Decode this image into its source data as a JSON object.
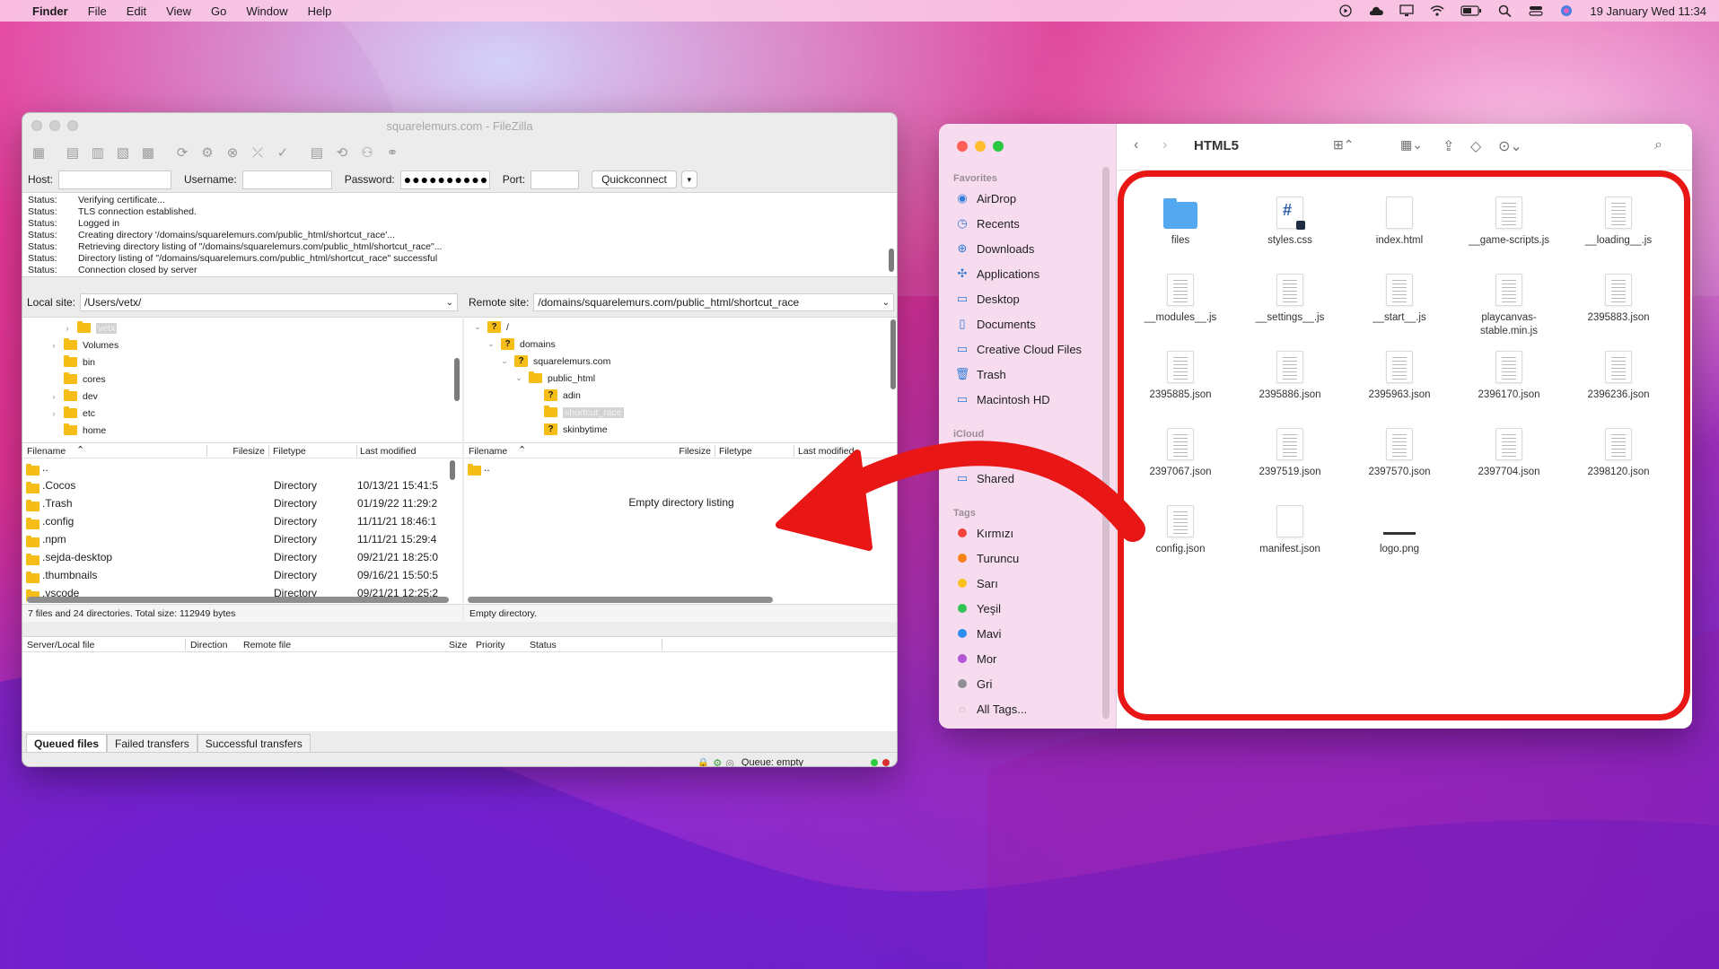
{
  "menubar": {
    "app": "Finder",
    "items": [
      "File",
      "Edit",
      "View",
      "Go",
      "Window",
      "Help"
    ],
    "clock": "19 January Wed  11:34"
  },
  "filezilla": {
    "title": "squarelemurs.com - FileZilla",
    "quickconnect": {
      "host_label": "Host:",
      "host_value": "",
      "username_label": "Username:",
      "username_value": "",
      "password_label": "Password:",
      "password_value": "●●●●●●●●●●●●",
      "port_label": "Port:",
      "port_value": "",
      "button": "Quickconnect"
    },
    "log": [
      {
        "k": "Status:",
        "v": "Verifying certificate..."
      },
      {
        "k": "Status:",
        "v": "TLS connection established."
      },
      {
        "k": "Status:",
        "v": "Logged in"
      },
      {
        "k": "Status:",
        "v": "Creating directory '/domains/squarelemurs.com/public_html/shortcut_race'..."
      },
      {
        "k": "Status:",
        "v": "Retrieving directory listing of \"/domains/squarelemurs.com/public_html/shortcut_race\"..."
      },
      {
        "k": "Status:",
        "v": "Directory listing of \"/domains/squarelemurs.com/public_html/shortcut_race\" successful"
      },
      {
        "k": "Status:",
        "v": "Connection closed by server"
      }
    ],
    "local": {
      "label": "Local site:",
      "path": "/Users/vetx/",
      "tree": [
        "vetx",
        "Volumes",
        "bin",
        "cores",
        "dev",
        "etc",
        "home"
      ],
      "headers": {
        "filename": "Filename",
        "filesize": "Filesize",
        "filetype": "Filetype",
        "modified": "Last modified"
      },
      "files": [
        {
          "name": "..",
          "type": "",
          "modified": ""
        },
        {
          "name": ".Cocos",
          "type": "Directory",
          "modified": "10/13/21 15:41:5"
        },
        {
          "name": ".Trash",
          "type": "Directory",
          "modified": "01/19/22 11:29:2"
        },
        {
          "name": ".config",
          "type": "Directory",
          "modified": "11/11/21 18:46:1"
        },
        {
          "name": ".npm",
          "type": "Directory",
          "modified": "11/11/21 15:29:4"
        },
        {
          "name": ".sejda-desktop",
          "type": "Directory",
          "modified": "09/21/21 18:25:0"
        },
        {
          "name": ".thumbnails",
          "type": "Directory",
          "modified": "09/16/21 15:50:5"
        },
        {
          "name": ".vscode",
          "type": "Directory",
          "modified": "09/21/21 12:25:2"
        }
      ],
      "status": "7 files and 24 directories. Total size: 112949 bytes"
    },
    "remote": {
      "label": "Remote site:",
      "path": "/domains/squarelemurs.com/public_html/shortcut_race",
      "tree": [
        "/",
        "domains",
        "squarelemurs.com",
        "public_html",
        "adin",
        "shortcut_race",
        "skinbytime"
      ],
      "headers": {
        "filename": "Filename",
        "filesize": "Filesize",
        "filetype": "Filetype",
        "modified": "Last modified"
      },
      "files": [
        {
          "name": ".."
        }
      ],
      "empty": "Empty directory listing",
      "status": "Empty directory."
    },
    "queue": {
      "headers": {
        "local": "Server/Local file",
        "direction": "Direction",
        "remote": "Remote file",
        "size": "Size",
        "priority": "Priority",
        "status": "Status"
      },
      "tabs": [
        "Queued files",
        "Failed transfers",
        "Successful transfers"
      ],
      "queue_status": "Queue: empty"
    }
  },
  "finder": {
    "folder_title": "HTML5",
    "sections": {
      "favorites": "Favorites",
      "icloud": "iCloud",
      "tags": "Tags"
    },
    "favorites": [
      "AirDrop",
      "Recents",
      "Downloads",
      "Applications",
      "Desktop",
      "Documents",
      "Creative Cloud Files",
      "Trash",
      "Macintosh HD"
    ],
    "icloud": [
      "Shared"
    ],
    "tags": [
      {
        "name": "Kırmızı",
        "color": "#f0433a"
      },
      {
        "name": "Turuncu",
        "color": "#f7821b"
      },
      {
        "name": "Sarı",
        "color": "#f9c11c"
      },
      {
        "name": "Yeşil",
        "color": "#31c453"
      },
      {
        "name": "Mavi",
        "color": "#2d8ef0"
      },
      {
        "name": "Mor",
        "color": "#b157d6"
      },
      {
        "name": "Gri",
        "color": "#8e8e93"
      }
    ],
    "all_tags": "All Tags...",
    "files": [
      {
        "name": "files",
        "kind": "folder"
      },
      {
        "name": "styles.css",
        "kind": "css"
      },
      {
        "name": "index.html",
        "kind": "blank"
      },
      {
        "name": "__game-scripts.js",
        "kind": "doc"
      },
      {
        "name": "__loading__.js",
        "kind": "doc"
      },
      {
        "name": "__modules__.js",
        "kind": "doc"
      },
      {
        "name": "__settings__.js",
        "kind": "doc"
      },
      {
        "name": "__start__.js",
        "kind": "doc"
      },
      {
        "name": "playcanvas-stable.min.js",
        "kind": "doc"
      },
      {
        "name": "2395883.json",
        "kind": "doc"
      },
      {
        "name": "2395885.json",
        "kind": "doc"
      },
      {
        "name": "2395886.json",
        "kind": "doc"
      },
      {
        "name": "2395963.json",
        "kind": "doc"
      },
      {
        "name": "2396170.json",
        "kind": "doc"
      },
      {
        "name": "2396236.json",
        "kind": "doc"
      },
      {
        "name": "2397067.json",
        "kind": "doc"
      },
      {
        "name": "2397519.json",
        "kind": "doc"
      },
      {
        "name": "2397570.json",
        "kind": "doc"
      },
      {
        "name": "2397704.json",
        "kind": "doc"
      },
      {
        "name": "2398120.json",
        "kind": "doc"
      },
      {
        "name": "config.json",
        "kind": "doc"
      },
      {
        "name": "manifest.json",
        "kind": "blank"
      },
      {
        "name": "logo.png",
        "kind": "img"
      }
    ]
  },
  "colors": {
    "highlight": "#e91616",
    "folder": "#53a8ef",
    "fz_folder": "#f7bd17"
  }
}
